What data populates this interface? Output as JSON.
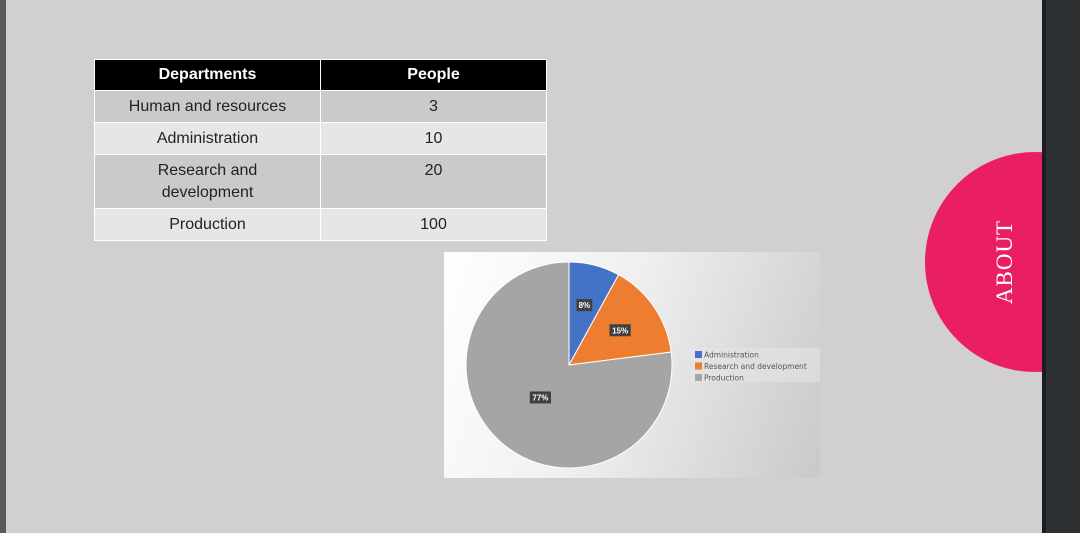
{
  "table": {
    "headers": [
      "Departments",
      "People"
    ],
    "rows": [
      {
        "department": "Human and resources",
        "people": "3"
      },
      {
        "department": "Administration",
        "people": "10"
      },
      {
        "department": "Research and development",
        "people": "20"
      },
      {
        "department": "Production",
        "people": "100"
      }
    ]
  },
  "chart_data": {
    "type": "pie",
    "categories": [
      "Administration",
      "Research and development",
      "Production"
    ],
    "values": [
      8,
      15,
      77
    ],
    "data_labels": [
      "8%",
      "15%",
      "77%"
    ],
    "colors": [
      "#4472c4",
      "#ed7d31",
      "#a5a5a5"
    ],
    "legend": {
      "placement": "right",
      "entries": [
        "Administration",
        "Research and development",
        "Production"
      ]
    }
  },
  "badge": {
    "label": "ABOUT",
    "color": "#e91e63"
  }
}
